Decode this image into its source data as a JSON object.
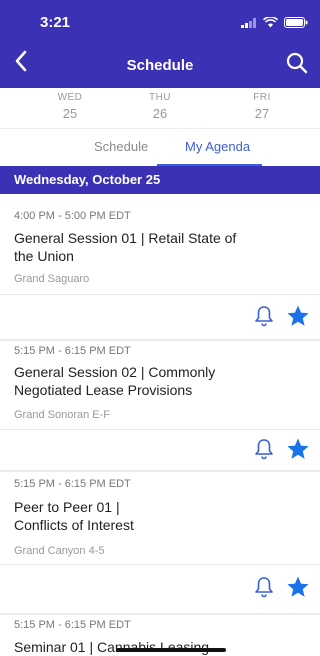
{
  "status": {
    "time": "3:21"
  },
  "nav": {
    "title": "Schedule",
    "back_icon": "chevron-left-icon",
    "search_icon": "search-icon"
  },
  "days": [
    {
      "dow": "WED",
      "num": "25"
    },
    {
      "dow": "THU",
      "num": "26"
    },
    {
      "dow": "FRI",
      "num": "27"
    }
  ],
  "tabs": {
    "schedule": "Schedule",
    "agenda": "My Agenda",
    "active": "My Agenda"
  },
  "date_header": "Wednesday, October 25",
  "sessions": [
    {
      "time": "4:00 PM - 5:00 PM EDT",
      "title": "General Session 01 | Retail State of the Union",
      "location": "Grand Saguaro"
    },
    {
      "time": "5:15 PM - 6:15 PM EDT",
      "title": "General Session 02 | Commonly Negotiated Lease Provisions",
      "location": "Grand Sonoran E-F"
    },
    {
      "time": "5:15 PM - 6:15 PM EDT",
      "title": "Peer to Peer 01 | Conflicts of Interest",
      "location": "Grand Canyon 4-5"
    },
    {
      "time": "5:15 PM - 6:15 PM EDT",
      "title": "Seminar 01 | Cannabis Leasing",
      "location": ""
    }
  ],
  "colors": {
    "brand": "#3b31b5",
    "accent": "#3a5fd8",
    "star": "#1a73e8"
  }
}
